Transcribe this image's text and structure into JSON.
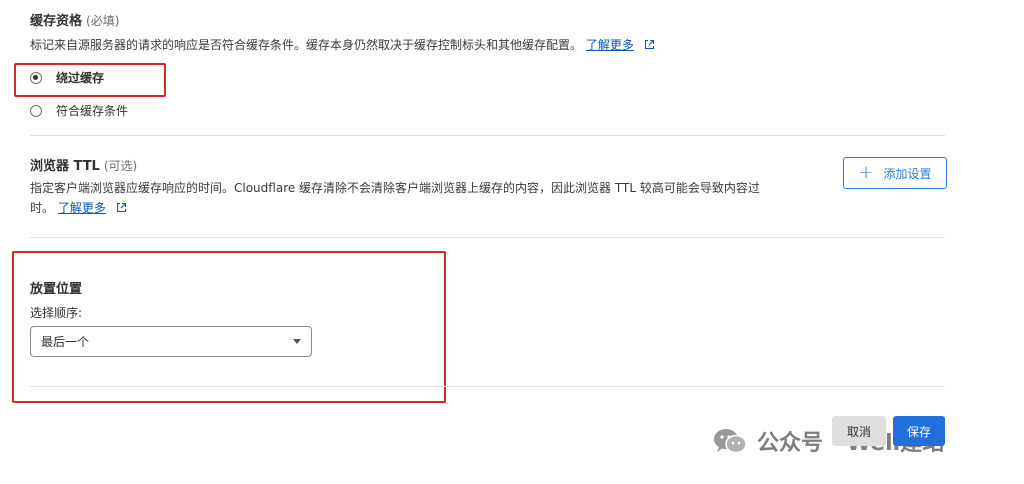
{
  "cache_eligibility": {
    "title": "缓存资格",
    "required": "(必填)",
    "description": "标记来自源服务器的请求的响应是否符合缓存条件。缓存本身仍然取决于缓存控制标头和其他缓存配置。",
    "learn_more": "了解更多",
    "options": [
      {
        "label": "绕过缓存",
        "checked": true
      },
      {
        "label": "符合缓存条件",
        "checked": false
      }
    ]
  },
  "browser_ttl": {
    "title": "浏览器 TTL",
    "optional": "(可选)",
    "description_line1": "指定客户端浏览器应缓存响应的时间。Cloudflare 缓存清除不会清除客户端浏览器上缓存的内容，因此浏览器 TTL 较高可能会导致内容过",
    "description_line2": "时。",
    "learn_more": "了解更多",
    "add_button": "添加设置"
  },
  "placement": {
    "title": "放置位置",
    "select_label": "选择顺序:",
    "selected": "最后一个"
  },
  "actions": {
    "cancel": "取消",
    "save": "保存"
  },
  "watermark": {
    "text": "公众号 · Well建站"
  },
  "colors": {
    "accent": "#1f6fdc",
    "highlight_box": "#cf2b2b",
    "link": "#0b58b0"
  }
}
